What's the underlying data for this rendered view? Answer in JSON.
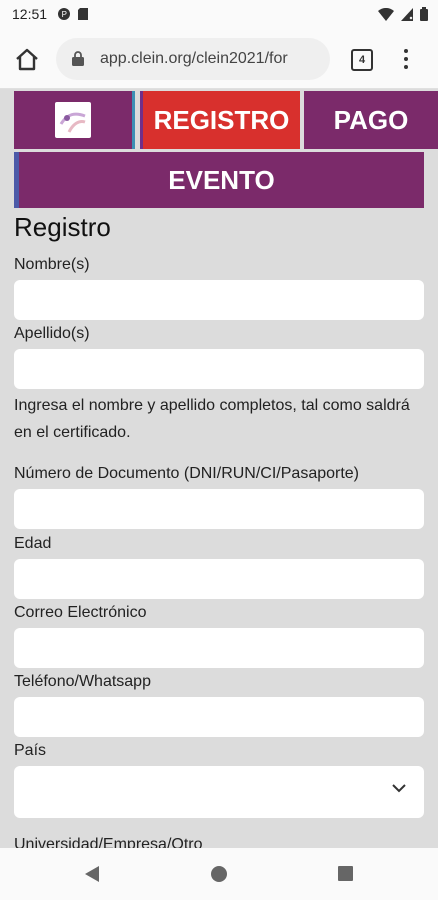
{
  "status": {
    "time": "12:51"
  },
  "browser": {
    "url": "app.clein.org/clein2021/for",
    "tab_count": "4"
  },
  "nav": {
    "registro": "REGISTRO",
    "pago": "PAGO",
    "evento": "EVENTO"
  },
  "form": {
    "title": "Registro",
    "nombre_label": "Nombre(s)",
    "apellido_label": "Apellido(s)",
    "help_text": "Ingresa el nombre y apellido completos, tal como saldrá en el certificado.",
    "documento_label": "Número de Documento (DNI/RUN/CI/Pasaporte)",
    "edad_label": "Edad",
    "correo_label": "Correo Electrónico",
    "telefono_label": "Teléfono/Whatsapp",
    "pais_label": "País",
    "universidad_label": "Universidad/Empresa/Otro"
  },
  "colors": {
    "purple": "#7b2a6a",
    "red": "#d8302d"
  }
}
